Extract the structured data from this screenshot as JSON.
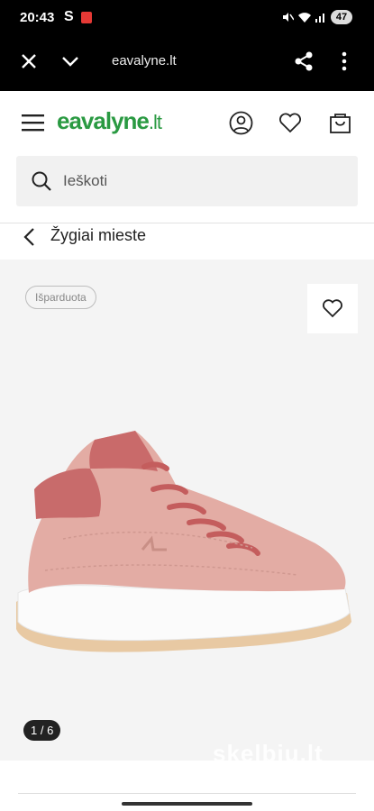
{
  "status_bar": {
    "time": "20:43",
    "s_label": "S",
    "battery": "47",
    "icons": [
      "youtube-icon",
      "mute-icon",
      "wifi-icon",
      "signal-icon"
    ]
  },
  "browser": {
    "url": "eavalyne.lt",
    "icons": [
      "close-icon",
      "chevron-down-icon",
      "share-icon",
      "more-icon"
    ]
  },
  "site": {
    "logo_main": "eavalyne",
    "logo_suffix": ".lt",
    "brand_color": "#2a9a42",
    "icons": [
      "menu-icon",
      "user-icon",
      "heart-icon",
      "bag-icon"
    ]
  },
  "search": {
    "placeholder": "Ieškoti"
  },
  "breadcrumb": {
    "label": "Žygiai mieste"
  },
  "product": {
    "badge": "Išparduota",
    "image_counter": "1 / 6",
    "watermark": "skelbiu.lt"
  }
}
